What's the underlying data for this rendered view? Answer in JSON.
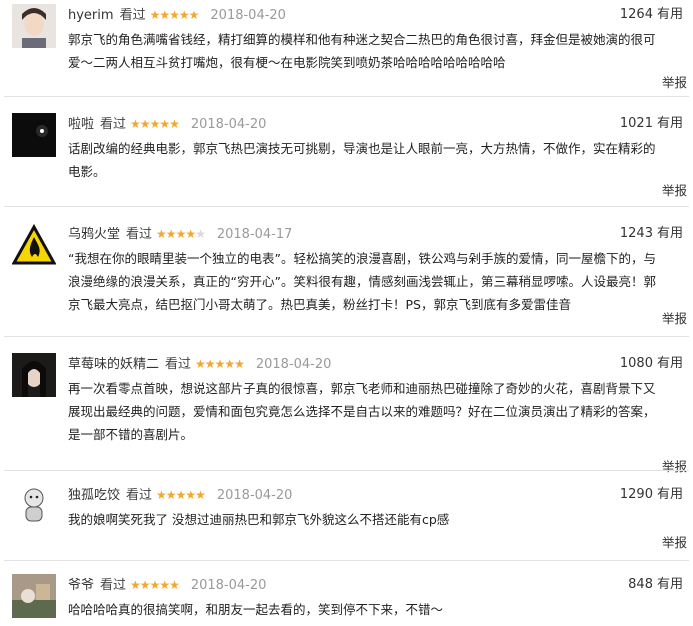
{
  "useful_label": "有用",
  "watched_label": "看过",
  "report_label": "举报",
  "colors": {
    "star": "#f3a72b",
    "star_empty": "#d9d9d9",
    "date": "#9a9a9a",
    "divider": "#e3e3e3"
  },
  "reviews": [
    {
      "user": "hyerim",
      "rating": 5,
      "date": "2018-04-20",
      "useful": "1264",
      "lines": [
        "郭京飞的角色满嘴省钱经，精打细算的模样和他有种迷之契合二热巴的角色很讨喜，拜金但是被她演的很可",
        "爱～二两人相互斗贫打嘴炮，很有梗～在电影院笑到喷奶茶哈哈哈哈哈哈哈哈哈"
      ]
    },
    {
      "user": "啦啦",
      "rating": 5,
      "date": "2018-04-20",
      "useful": "1021",
      "lines": [
        "话剧改编的经典电影，郭京飞热巴演技无可挑剔，导演也是让人眼前一亮，大方热情，不做作，实在精彩的",
        "电影。"
      ]
    },
    {
      "user": "乌鸦火堂",
      "rating": 4,
      "date": "2018-04-17",
      "useful": "1243",
      "lines": [
        "“我想在你的眼睛里装一个独立的电表”。轻松搞笑的浪漫喜剧，铁公鸡与剁手族的爱情，同一屋檐下的，与",
        "浪漫绝缘的浪漫关系，真正的“穷开心”。笑料很有趣，情感刻画浅尝辄止，第三幕稍显啰嗦。人设最亮！郭",
        "京飞最大亮点，结巴抠门小哥太萌了。热巴真美，粉丝打卡！PS，郭京飞到底有多爱雷佳音"
      ]
    },
    {
      "user": "草莓味的妖精二",
      "rating": 5,
      "date": "2018-04-20",
      "useful": "1080",
      "lines": [
        "再一次看零点首映，想说这部片子真的很惊喜，郭京飞老师和迪丽热巴碰撞除了奇妙的火花，喜剧背景下又",
        "展现出最经典的问题，爱情和面包究竟怎么选择不是自古以来的难题吗？好在二位演员演出了精彩的答案，",
        "是一部不错的喜剧片。"
      ]
    },
    {
      "user": "独孤吃饺",
      "rating": 5,
      "date": "2018-04-20",
      "useful": "1290",
      "lines": [
        "我的娘啊笑死我了 没想过迪丽热巴和郭京飞外貌这么不搭还能有cp感"
      ]
    },
    {
      "user": "爷爷",
      "rating": 5,
      "date": "2018-04-20",
      "useful": "848",
      "lines": [
        "哈哈哈哈真的很搞笑啊，和朋友一起去看的，笑到停不下来，不错～"
      ]
    }
  ]
}
